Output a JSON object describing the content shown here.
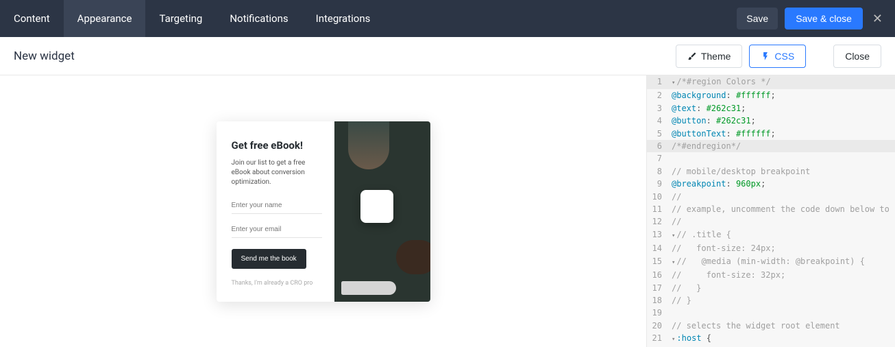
{
  "topnav": {
    "tabs": [
      "Content",
      "Appearance",
      "Targeting",
      "Notifications",
      "Integrations"
    ],
    "active": 1,
    "save": "Save",
    "save_close": "Save & close"
  },
  "subheader": {
    "title": "New widget",
    "theme_btn": "Theme",
    "css_btn": "CSS",
    "close_btn": "Close"
  },
  "widget": {
    "title": "Get free eBook!",
    "desc": "Join our list to get a free eBook about conversion optimization.",
    "name_placeholder": "Enter your name",
    "email_placeholder": "Enter your email",
    "cta": "Send me the book",
    "footer": "Thanks, I'm already a CRO pro"
  },
  "code": {
    "lines": [
      {
        "n": 1,
        "region": true,
        "fold": true,
        "tokens": [
          [
            "comment",
            "/*#region Colors */"
          ]
        ]
      },
      {
        "n": 2,
        "tokens": [
          [
            "at",
            "@background"
          ],
          [
            "punct",
            ": "
          ],
          [
            "hex",
            "#ffffff"
          ],
          [
            "punct",
            ";"
          ]
        ]
      },
      {
        "n": 3,
        "tokens": [
          [
            "at",
            "@text"
          ],
          [
            "punct",
            ": "
          ],
          [
            "hex",
            "#262c31"
          ],
          [
            "punct",
            ";"
          ]
        ]
      },
      {
        "n": 4,
        "tokens": [
          [
            "at",
            "@button"
          ],
          [
            "punct",
            ": "
          ],
          [
            "hex",
            "#262c31"
          ],
          [
            "punct",
            ";"
          ]
        ]
      },
      {
        "n": 5,
        "tokens": [
          [
            "at",
            "@buttonText"
          ],
          [
            "punct",
            ": "
          ],
          [
            "hex",
            "#ffffff"
          ],
          [
            "punct",
            ";"
          ]
        ]
      },
      {
        "n": 6,
        "region": true,
        "tokens": [
          [
            "comment",
            "/*#endregion*/"
          ]
        ]
      },
      {
        "n": 7,
        "tokens": []
      },
      {
        "n": 8,
        "tokens": [
          [
            "comment",
            "// mobile/desktop breakpoint"
          ]
        ]
      },
      {
        "n": 9,
        "tokens": [
          [
            "at",
            "@breakpoint"
          ],
          [
            "punct",
            ": "
          ],
          [
            "num",
            "960px"
          ],
          [
            "punct",
            ";"
          ]
        ]
      },
      {
        "n": 10,
        "tokens": [
          [
            "comment",
            "//"
          ]
        ]
      },
      {
        "n": 11,
        "tokens": [
          [
            "comment",
            "// example, uncomment the code down below to see how it"
          ]
        ]
      },
      {
        "n": 12,
        "tokens": [
          [
            "comment",
            "//"
          ]
        ]
      },
      {
        "n": 13,
        "fold": true,
        "tokens": [
          [
            "comment",
            "// .title {"
          ]
        ]
      },
      {
        "n": 14,
        "tokens": [
          [
            "comment",
            "//   font-size: 24px;"
          ]
        ]
      },
      {
        "n": 15,
        "fold": true,
        "tokens": [
          [
            "comment",
            "//   @media (min-width: @breakpoint) {"
          ]
        ]
      },
      {
        "n": 16,
        "tokens": [
          [
            "comment",
            "//     font-size: 32px;"
          ]
        ]
      },
      {
        "n": 17,
        "tokens": [
          [
            "comment",
            "//   }"
          ]
        ]
      },
      {
        "n": 18,
        "tokens": [
          [
            "comment",
            "// }"
          ]
        ]
      },
      {
        "n": 19,
        "tokens": []
      },
      {
        "n": 20,
        "tokens": [
          [
            "comment",
            "// selects the widget root element"
          ]
        ]
      },
      {
        "n": 21,
        "fold": true,
        "tokens": [
          [
            "sel",
            ":host"
          ],
          [
            "punct",
            " {"
          ]
        ]
      }
    ]
  }
}
